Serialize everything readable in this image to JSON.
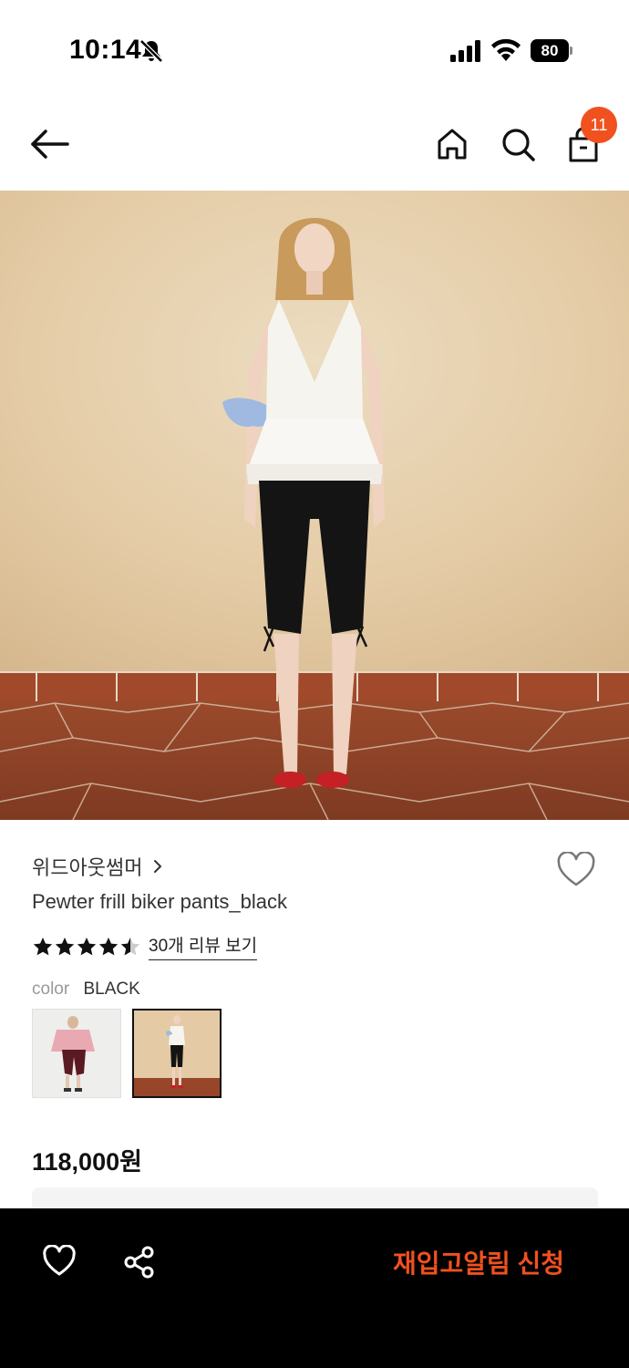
{
  "status_bar": {
    "time": "10:14",
    "battery": "80",
    "icons": [
      "bell-slash-icon",
      "cellular-signal-icon",
      "wifi-icon",
      "battery-icon"
    ]
  },
  "nav": {
    "icons": [
      "arrow-left-icon",
      "home-icon",
      "search-icon",
      "shopping-bag-icon"
    ],
    "bag_badge": "11"
  },
  "product": {
    "brand": "위드아웃썸머",
    "title": "Pewter frill biker pants_black",
    "rating": 4.5,
    "review_link": "30개 리뷰 보기",
    "color_label": "color",
    "color_value": "BLACK",
    "price": "118,000원",
    "colors": {
      "accent": "#f0511e",
      "wall": "#e7d0ae",
      "floor": "#9a4a2c"
    }
  },
  "bottom_bar": {
    "icons": [
      "heart-icon",
      "share-icon"
    ],
    "restock_label": "재입고알림 신청"
  }
}
